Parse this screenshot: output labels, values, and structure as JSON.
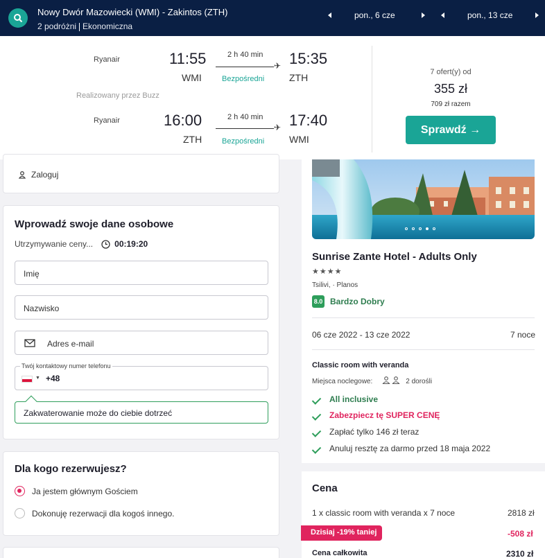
{
  "header": {
    "route": "Nowy Dwór Mazowiecki (WMI) - Zakintos (ZTH)",
    "travelers": "2 podróżni",
    "cabin": "Ekonomiczna",
    "depart_date": "pon., 6 cze",
    "return_date": "pon., 13 cze"
  },
  "flights": {
    "outbound": {
      "airline": "Ryanair",
      "dep_time": "11:55",
      "dep_code": "WMI",
      "duration": "2 h 40 min",
      "stops": "Bezpośredni",
      "arr_time": "15:35",
      "arr_code": "ZTH"
    },
    "operated_by": "Realizowany przez Buzz",
    "inbound": {
      "airline": "Ryanair",
      "dep_time": "16:00",
      "dep_code": "ZTH",
      "duration": "2 h 40 min",
      "stops": "Bezpośredni",
      "arr_time": "17:40",
      "arr_code": "WMI"
    },
    "offers": "7 ofert(y) od",
    "price": "355 zł",
    "total": "709 zł razem",
    "check_label": "Sprawdź →"
  },
  "login": {
    "label": "Zaloguj"
  },
  "personal": {
    "title": "Wprowadź swoje dane osobowe",
    "hold_label": "Utrzymywanie ceny...",
    "timer": "00:19:20",
    "first_name_placeholder": "Imię",
    "last_name_placeholder": "Nazwisko",
    "email_placeholder": "Adres e-mail",
    "phone_legend": "Twój kontaktowy numer telefonu",
    "phone_prefix": "+48",
    "notice": "Zakwaterowanie może do ciebie dotrzeć"
  },
  "booking_for": {
    "title": "Dla kogo rezerwujesz?",
    "options": [
      "Ja jestem głównym Gościem",
      "Dokonuję rezerwacji dla kogoś innego."
    ]
  },
  "hotel": {
    "name": "Sunrise Zante Hotel - Adults Only",
    "stars": "★★★★",
    "location": "Tsilivi, · Planos",
    "score": "8.0",
    "score_label": "Bardzo Dobry",
    "dates": "06 cze 2022 - 13 cze 2022",
    "nights": "7 noce",
    "room": "Classic room with veranda",
    "beds_label": "Miejsca noclegowe:",
    "guests": "2 dorośli",
    "features": [
      "All inclusive",
      "Zabezpiecz tę SUPER CENĘ",
      "Zapłać tylko 146 zł teraz",
      "Anuluj resztę za darmo przed 18 maja 2022"
    ]
  },
  "price": {
    "title": "Cena",
    "line_label": "1 x classic room with veranda x 7 noce",
    "line_value": "2818 zł",
    "discount_label": "Dzisiaj -19% taniej",
    "discount_value": "-508 zł",
    "total_label": "Cena całkowita",
    "total_value": "2310 zł"
  },
  "colors": {
    "navy": "#0a1f44",
    "teal": "#1aa596",
    "green": "#2e9e5b",
    "pink": "#e0245e"
  }
}
